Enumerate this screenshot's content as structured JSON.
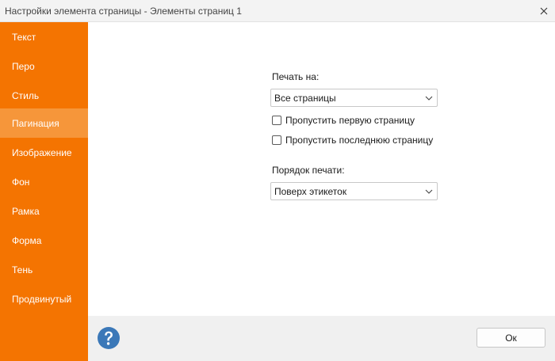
{
  "window": {
    "title": "Настройки элемента страницы - Элементы страниц 1",
    "close_icon": "close-icon"
  },
  "sidebar": {
    "accent_color": "#f47401",
    "active_color": "#f6963a",
    "items": [
      {
        "label": "Текст"
      },
      {
        "label": "Перо"
      },
      {
        "label": "Стиль"
      },
      {
        "label": "Пагинация",
        "active": true
      },
      {
        "label": "Изображение"
      },
      {
        "label": "Фон"
      },
      {
        "label": "Рамка"
      },
      {
        "label": "Форма"
      },
      {
        "label": "Тень"
      },
      {
        "label": "Продвинутый"
      }
    ]
  },
  "main": {
    "print_on_label": "Печать на:",
    "print_on_value": "Все страницы",
    "skip_first_label": "Пропустить первую страницу",
    "skip_first_checked": false,
    "skip_last_label": "Пропустить последнюю страницу",
    "skip_last_checked": false,
    "print_order_label": "Порядок печати:",
    "print_order_value": "Поверх этикеток"
  },
  "footer": {
    "help_icon": "help-icon",
    "help_color": "#3b78b8",
    "ok_label": "Ок"
  }
}
